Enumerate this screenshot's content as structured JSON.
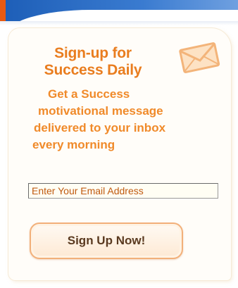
{
  "signup": {
    "title_line1": "Sign-up for",
    "title_line2": "Success Daily",
    "description_lines": [
      "Get a Success",
      "motivational message",
      "delivered to your inbox",
      "every morning"
    ],
    "email_placeholder": "Enter Your Email Address",
    "button_label": "Sign Up Now!"
  },
  "icons": {
    "envelope": "envelope-icon"
  },
  "colors": {
    "accent_orange": "#e97d1f",
    "text_orange": "#f08a2a",
    "banner_blue": "#1e5fb8",
    "button_text": "#5a3a20"
  }
}
